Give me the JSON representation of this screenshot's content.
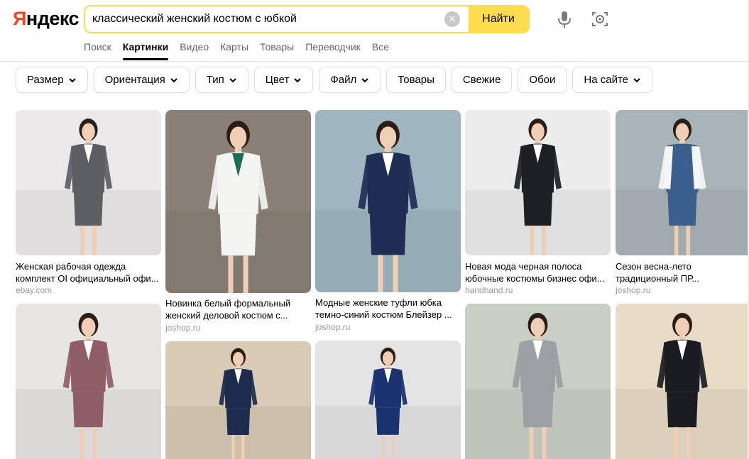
{
  "logo": {
    "first": "Я",
    "rest": "ндекс"
  },
  "search": {
    "query": "классический женский костюм с юбкой",
    "submit_label": "Найти"
  },
  "services": [
    "Поиск",
    "Картинки",
    "Видео",
    "Карты",
    "Товары",
    "Переводчик",
    "Все"
  ],
  "active_service": "Картинки",
  "filters": [
    {
      "label": "Размер",
      "dropdown": true
    },
    {
      "label": "Ориентация",
      "dropdown": true
    },
    {
      "label": "Тип",
      "dropdown": true
    },
    {
      "label": "Цвет",
      "dropdown": true
    },
    {
      "label": "Файл",
      "dropdown": true
    },
    {
      "label": "Товары",
      "dropdown": false
    },
    {
      "label": "Свежие",
      "dropdown": false
    },
    {
      "label": "Обои",
      "dropdown": false
    },
    {
      "label": "На сайте",
      "dropdown": true
    }
  ],
  "results": [
    {
      "line1": "Женская рабочая одежда",
      "line2": "комплект OI официальный офи...",
      "source": "ebay.com",
      "suit": "grey-double",
      "bg": "#ebe9ea",
      "jacket": "#5c5e62"
    },
    {
      "line1": "Новинка белый формальный",
      "line2": "женский деловой костюм с...",
      "source": "joshop.ru",
      "suit": "white",
      "bg": "#8a8077",
      "jacket": "#f4f4f2"
    },
    {
      "line1": "Модные женские туфли юбка",
      "line2": "темно-синий костюм Блейзер ...",
      "source": "joshop.ru",
      "suit": "navy",
      "bg": "#9fb6c0",
      "jacket": "#1f2d55"
    },
    {
      "line1": "Новая мода черная полоса",
      "line2": "юбочные костюмы бизнес офи...",
      "source": "handhand.ru",
      "suit": "black",
      "bg": "#ececec",
      "jacket": "#1e1f24"
    },
    {
      "line1": "Сезон весна-лето",
      "line2": "традиционный ПР...",
      "source": "joshop.ru",
      "suit": "blue-dress",
      "bg": "#a9b4b9",
      "jacket": "#f5f5f5"
    },
    {
      "suit": "mauve",
      "bg": "#e8e6e4",
      "jacket": "#8e5d66"
    },
    {
      "suit": "navy2",
      "bg": "#d9cbb4",
      "jacket": "#1d2b4f"
    },
    {
      "suit": "navy3",
      "bg": "#e4e4e4",
      "jacket": "#1b3270"
    },
    {
      "suit": "grey-light",
      "bg": "#c9cfc4",
      "jacket": "#9c9fa3"
    },
    {
      "suit": "black2",
      "bg": "#e8dcc7",
      "jacket": "#1b1c22"
    }
  ]
}
